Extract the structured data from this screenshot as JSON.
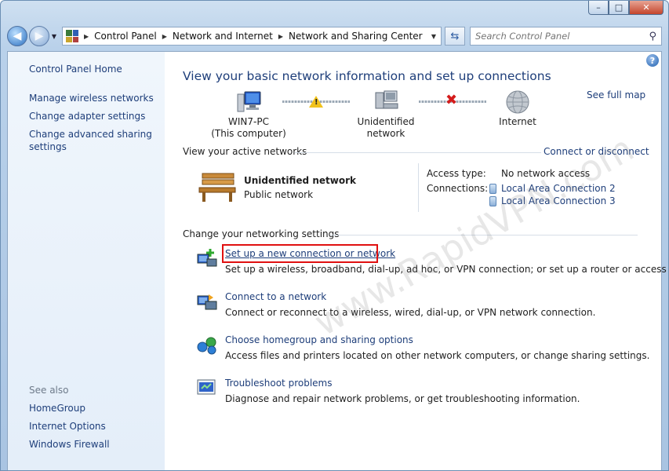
{
  "window": {
    "caption": {
      "minimize": "–",
      "maximize": "□",
      "close": "✕"
    }
  },
  "nav": {
    "breadcrumbs": [
      "Control Panel",
      "Network and Internet",
      "Network and Sharing Center"
    ],
    "search_placeholder": "Search Control Panel"
  },
  "sidebar": {
    "home": "Control Panel Home",
    "items": [
      "Manage wireless networks",
      "Change adapter settings",
      "Change advanced sharing settings"
    ],
    "see_also": "See also",
    "see_also_items": [
      "HomeGroup",
      "Internet Options",
      "Windows Firewall"
    ]
  },
  "main": {
    "title": "View your basic network information and set up connections",
    "see_full_map": "See full map",
    "map": {
      "computer_name": "WIN7-PC",
      "computer_sub": "(This computer)",
      "network": "Unidentified network",
      "internet": "Internet"
    },
    "active": {
      "heading": "View your active networks",
      "connect_link": "Connect or disconnect",
      "network_name": "Unidentified network",
      "network_type": "Public network",
      "access_label": "Access type:",
      "access_value": "No network access",
      "connections_label": "Connections:",
      "connections": [
        "Local Area Connection 2",
        "Local Area Connection 3"
      ]
    },
    "settings": {
      "heading": "Change your networking settings",
      "tasks": [
        {
          "link": "Set up a new connection or network",
          "desc": "Set up a wireless, broadband, dial-up, ad hoc, or VPN connection; or set up a router or access point."
        },
        {
          "link": "Connect to a network",
          "desc": "Connect or reconnect to a wireless, wired, dial-up, or VPN network connection."
        },
        {
          "link": "Choose homegroup and sharing options",
          "desc": "Access files and printers located on other network computers, or change sharing settings."
        },
        {
          "link": "Troubleshoot problems",
          "desc": "Diagnose and repair network problems, or get troubleshooting information."
        }
      ]
    }
  },
  "watermark": "www.RapidVPN.com",
  "colors": {
    "link": "#1e3e7a",
    "highlight": "#e01010",
    "sidebar_bg": "#e4eef9"
  }
}
